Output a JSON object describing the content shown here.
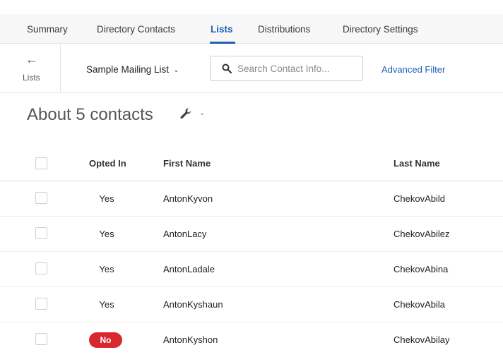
{
  "tabs": [
    {
      "label": "Summary",
      "active": false
    },
    {
      "label": "Directory Contacts",
      "active": false
    },
    {
      "label": "Lists",
      "active": true
    },
    {
      "label": "Distributions",
      "active": false
    },
    {
      "label": "Directory Settings",
      "active": false
    }
  ],
  "toolbar": {
    "back_label": "Lists",
    "list_name": "Sample Mailing List",
    "search_placeholder": "Search Contact Info...",
    "search_value": "",
    "advanced_filter": "Advanced Filter"
  },
  "heading": "About 5 contacts",
  "table": {
    "columns": [
      "Opted In",
      "First Name",
      "Last Name"
    ],
    "rows": [
      {
        "opted_in": "Yes",
        "first_name": "AntonKyvon",
        "last_name": "ChekovAbild"
      },
      {
        "opted_in": "Yes",
        "first_name": "AntonLacy",
        "last_name": "ChekovAbilez"
      },
      {
        "opted_in": "Yes",
        "first_name": "AntonLadale",
        "last_name": "ChekovAbina"
      },
      {
        "opted_in": "Yes",
        "first_name": "AntonKyshaun",
        "last_name": "ChekovAbila"
      },
      {
        "opted_in": "No",
        "first_name": "AntonKyshon",
        "last_name": "ChekovAbilay"
      }
    ]
  },
  "colors": {
    "accent": "#1f5fb4",
    "no_badge": "#d7282f"
  },
  "icons": {
    "back": "left-arrow-icon",
    "list_dropdown": "chevron-down-icon",
    "search": "search-icon",
    "tools": "wrench-icon"
  }
}
